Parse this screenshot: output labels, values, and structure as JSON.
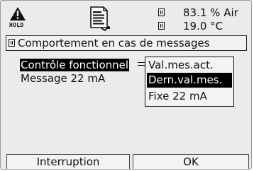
{
  "header": {
    "hold_label": "HOLD",
    "status_lines": [
      {
        "value": "83.1 % Air"
      },
      {
        "value": "19.0 °C"
      }
    ]
  },
  "title": "Comportement en cas de messages",
  "menu": {
    "items": [
      {
        "label": "Contrôle fonctionnel",
        "selected": true
      },
      {
        "label": "Message 22 mA",
        "selected": false
      }
    ]
  },
  "dropdown": {
    "options": [
      {
        "label": "Val.mes.act.",
        "selected": false
      },
      {
        "label": "Dern.val.mes.",
        "selected": true
      },
      {
        "label": "Fixe  22 mA",
        "selected": false
      }
    ]
  },
  "softkeys": {
    "left_label": "Interruption",
    "right_label": "OK"
  }
}
